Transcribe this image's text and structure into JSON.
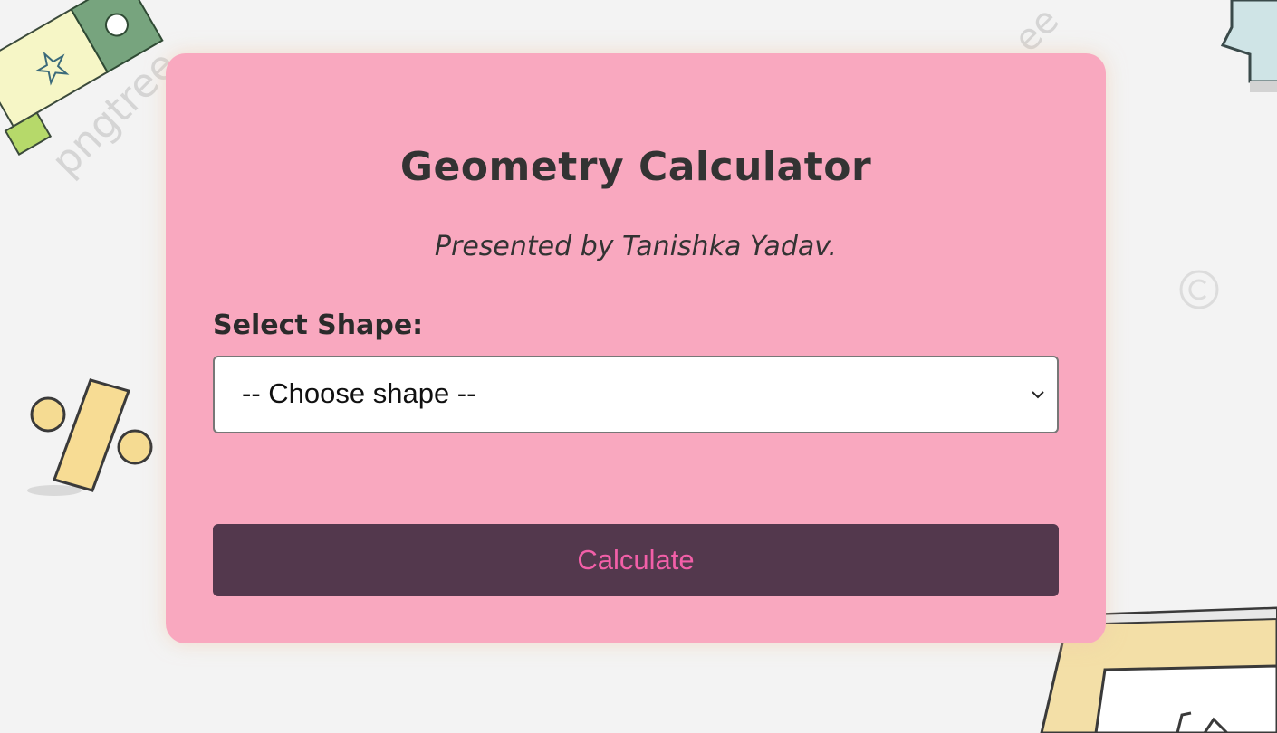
{
  "page": {
    "title": "Geometry Calculator",
    "subtitle": "Presented by Tanishka Yadav."
  },
  "form": {
    "shape_label": "Select Shape:",
    "shape_select": {
      "selected": "-- Choose shape --"
    },
    "calculate_label": "Calculate"
  },
  "background": {
    "watermark_text": "pngtree",
    "decorations": [
      "puzzle-doodle",
      "percent-sign-doodle",
      "blue-puzzle-doodle",
      "picture-frame-doodle",
      "copyright-icon"
    ]
  },
  "colors": {
    "page_bg": "#f3f3f3",
    "card_bg": "#f9a8bf",
    "button_bg": "#53384d",
    "button_text": "#f25fa8",
    "heading_text": "#333333"
  }
}
